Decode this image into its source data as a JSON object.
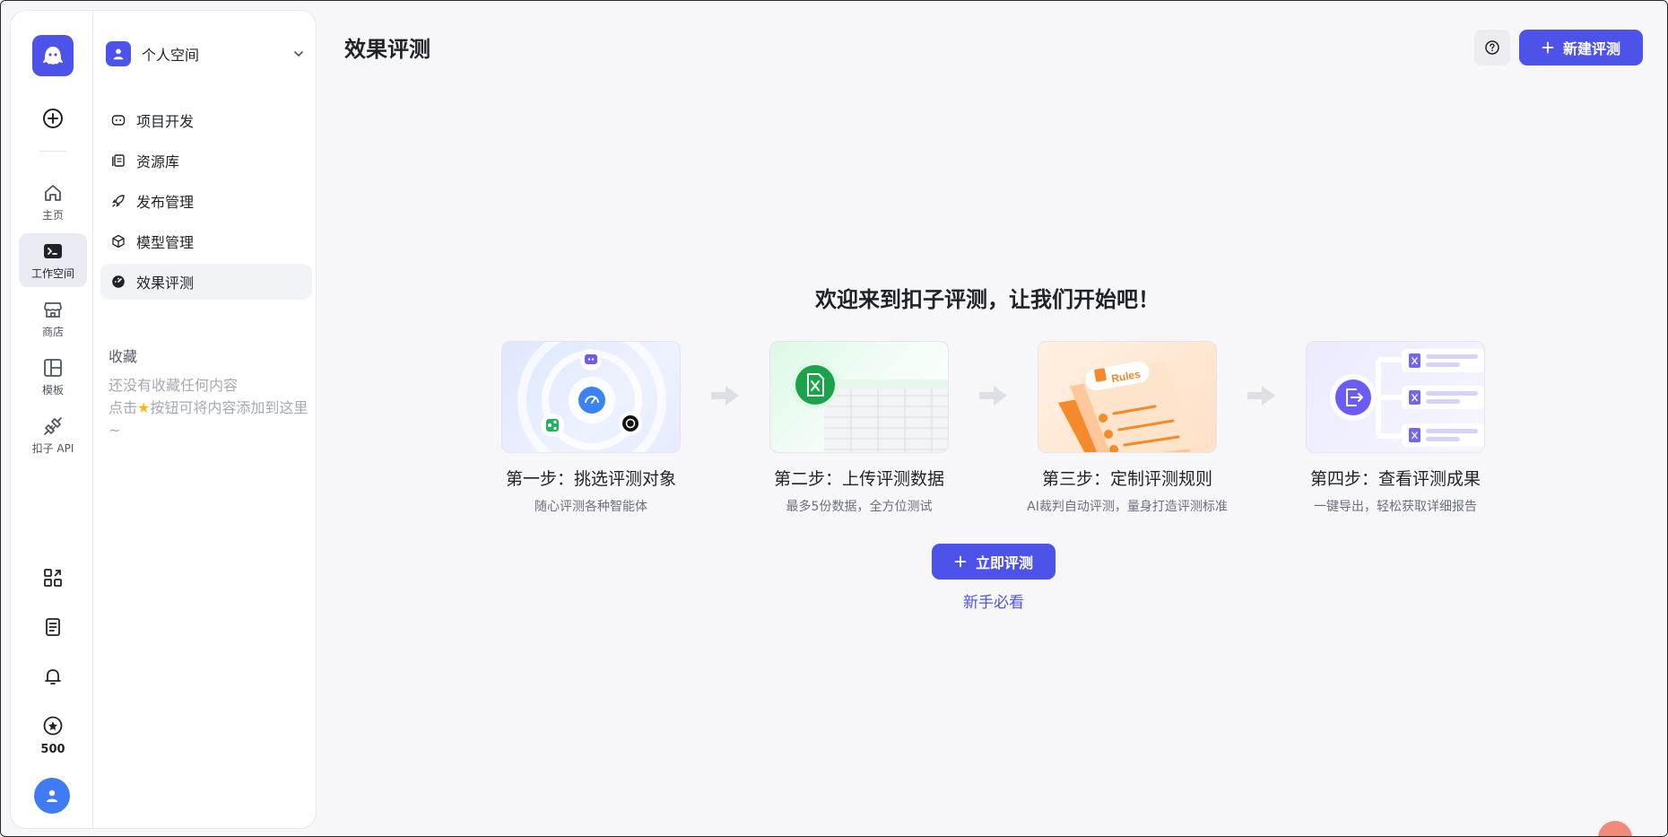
{
  "rail": {
    "items": [
      {
        "label": "主页",
        "icon": "home-icon"
      },
      {
        "label": "工作空间",
        "icon": "terminal-icon"
      },
      {
        "label": "商店",
        "icon": "store-icon"
      },
      {
        "label": "模板",
        "icon": "template-icon"
      },
      {
        "label": "扣子 API",
        "icon": "api-plug-icon"
      }
    ],
    "points": "500"
  },
  "sidebar": {
    "workspace": "个人空间",
    "nav": [
      {
        "label": "项目开发",
        "icon": "bot-icon"
      },
      {
        "label": "资源库",
        "icon": "library-icon"
      },
      {
        "label": "发布管理",
        "icon": "rocket-icon"
      },
      {
        "label": "模型管理",
        "icon": "model-cube-icon"
      },
      {
        "label": "效果评测",
        "icon": "gauge-icon"
      }
    ],
    "favorites_title": "收藏",
    "favorites_empty_line1": "还没有收藏任何内容",
    "favorites_empty_pre": "点击",
    "favorites_empty_post": "按钮可将内容添加到这里~"
  },
  "header": {
    "title": "效果评测",
    "new_button": "新建评测"
  },
  "main": {
    "welcome": "欢迎来到扣子评测，让我们开始吧！",
    "steps": [
      {
        "title": "第一步：挑选评测对象",
        "desc": "随心评测各种智能体"
      },
      {
        "title": "第二步：上传评测数据",
        "desc": "最多5份数据，全方位测试"
      },
      {
        "title": "第三步：定制评测规则",
        "desc": "AI裁判自动评测，量身打造评测标准"
      },
      {
        "title": "第四步：查看评测成果",
        "desc": "一键导出，轻松获取详细报告"
      }
    ],
    "rules_tag": "Rules",
    "start_button": "立即评测",
    "guide_link": "新手必看"
  },
  "colors": {
    "accent": "#4d53e8",
    "avatar": "#3f7cf3",
    "excel_green": "#1aa34a",
    "rules_orange": "#f48a2a"
  }
}
